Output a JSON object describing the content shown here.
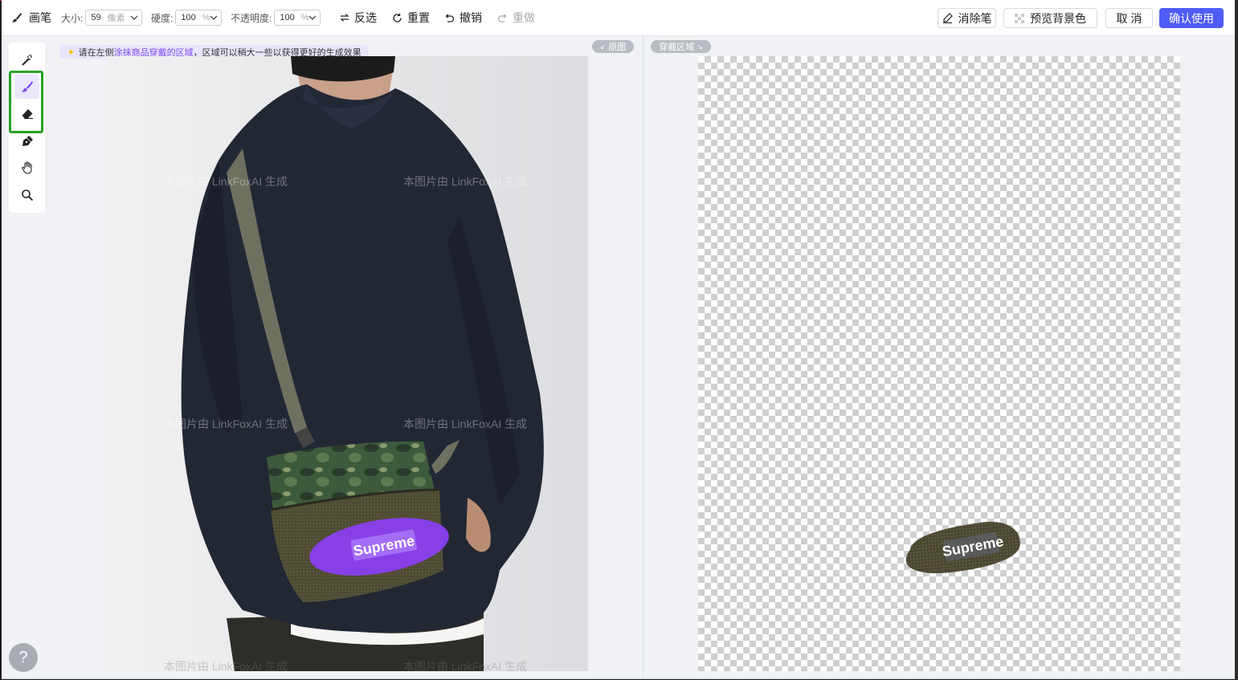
{
  "toolbar": {
    "tool_name": "画笔",
    "size_label": "大小:",
    "size_value": "59",
    "size_unit": "像素",
    "hardness_label": "硬度:",
    "hardness_value": "100",
    "hardness_unit": "%",
    "opacity_label": "不透明度:",
    "opacity_value": "100",
    "opacity_unit": "%",
    "invert_label": "反选",
    "reset_label": "重置",
    "undo_label": "撤销",
    "redo_label": "重做",
    "eraser_label": "消除笔",
    "preview_bg_label": "预览背景色",
    "cancel_label": "取 消",
    "confirm_label": "确认使用"
  },
  "rail": {
    "tools": [
      "magic-wand",
      "brush",
      "eraser",
      "pen",
      "hand",
      "zoom"
    ],
    "active": "brush"
  },
  "hint": {
    "prefix": "请在左侧",
    "highlight": "涂抹商品穿戴的区域",
    "suffix": "，区域可以稍大一些以获得更好的生成效果"
  },
  "tags": {
    "original": "原图",
    "wear_area": "穿戴区域"
  },
  "photo": {
    "watermark": "本图片由 LinkFoxAI 生成",
    "bag_logo": "Supreme"
  },
  "result": {
    "logo": "Supreme"
  },
  "help": "?",
  "colors": {
    "accent": "#4f5cf5",
    "brush_mask": "#8a3ff0",
    "highlight": "#27a025"
  }
}
